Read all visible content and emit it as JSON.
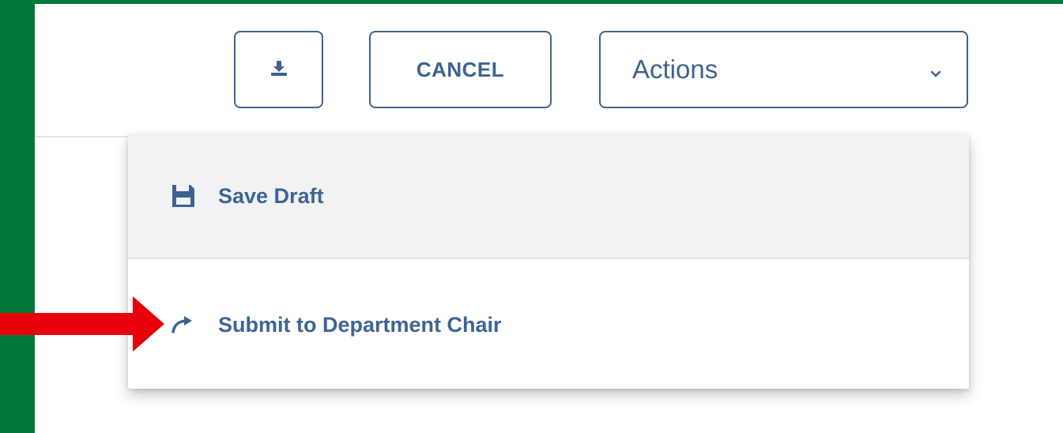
{
  "toolbar": {
    "download_icon": "download-icon",
    "cancel_label": "CANCEL",
    "actions_label": "Actions",
    "actions_chevron_icon": "chevron-down-icon"
  },
  "menu": {
    "items": [
      {
        "label": "Save Draft",
        "icon": "floppy-disk-icon"
      },
      {
        "label": "Submit to Department Chair",
        "icon": "share-arrow-icon"
      }
    ]
  },
  "colors": {
    "frame": "#04773b",
    "accent": "#3e6290",
    "menu_hover_bg": "#f1f2f4",
    "annotation_arrow": "#e8000b"
  }
}
